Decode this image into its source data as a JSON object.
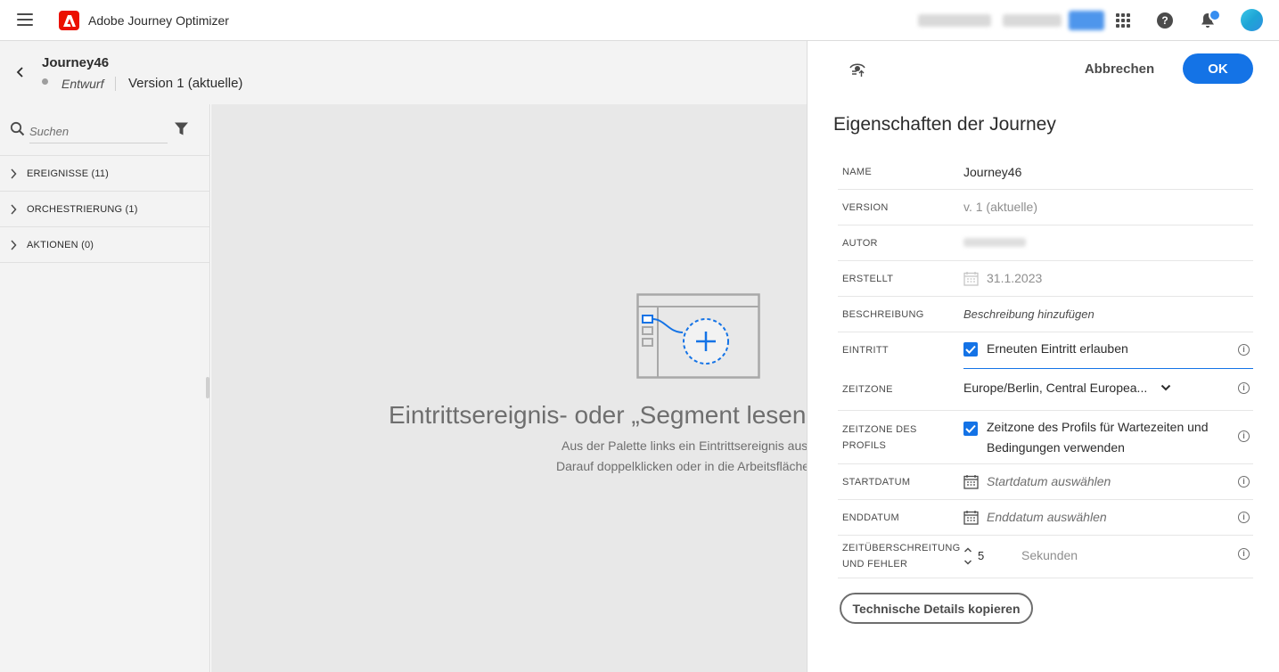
{
  "app": {
    "name": "Adobe Journey Optimizer"
  },
  "journey": {
    "title": "Journey46",
    "status": "Entwurf",
    "version": "Version 1 (aktuelle)"
  },
  "palette": {
    "search_placeholder": "Suchen",
    "items": [
      {
        "label": "EREIGNISSE (11)"
      },
      {
        "label": "ORCHESTRIERUNG (1)"
      },
      {
        "label": "AKTIONEN (0)"
      }
    ]
  },
  "canvas": {
    "title": "Eintrittsereignis- oder „Segment lesen\"-A",
    "line1": "Aus der Palette links ein Eintrittsereignis auswä",
    "line2": "Darauf doppelklicken oder in die Arbeitsfläche z"
  },
  "panel": {
    "cancel_label": "Abbrechen",
    "ok_label": "OK",
    "title": "Eigenschaften der Journey",
    "copy_button": "Technische Details kopieren",
    "props": {
      "name": {
        "label": "NAME",
        "value": "Journey46"
      },
      "version": {
        "label": "VERSION",
        "value": "v. 1 (aktuelle)"
      },
      "author": {
        "label": "AUTOR"
      },
      "created": {
        "label": "ERSTELLT",
        "value": "31.1.2023"
      },
      "description": {
        "label": "BESCHREIBUNG",
        "placeholder": "Beschreibung hinzufügen"
      },
      "entry": {
        "label": "EINTRITT",
        "value": "Erneuten Eintritt erlauben",
        "checked": true
      },
      "timezone": {
        "label": "ZEITZONE",
        "value": "Europe/Berlin, Central Europea..."
      },
      "profile_timezone": {
        "label_line1": "ZEITZONE DES",
        "label_line2": "PROFILS",
        "value_line1": "Zeitzone des Profils für Wartezeiten und",
        "value_line2": "Bedingungen verwenden",
        "checked": true
      },
      "start_date": {
        "label": "STARTDATUM",
        "placeholder": "Startdatum auswählen"
      },
      "end_date": {
        "label": "ENDDATUM",
        "placeholder": "Enddatum auswählen"
      },
      "timeout": {
        "label_line1": "ZEITÜBERSCHREITUNG",
        "label_line2": "UND FEHLER",
        "value": "5",
        "unit": "Sekunden"
      }
    }
  },
  "colors": {
    "accent": "#1473e6",
    "adobe_red": "#eb1000"
  }
}
